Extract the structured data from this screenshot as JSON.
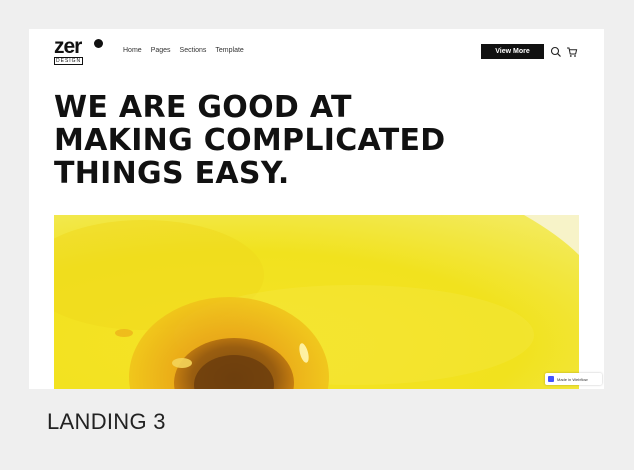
{
  "brand": {
    "wordmark": "zer",
    "sub": "DESIGN"
  },
  "nav": {
    "links": [
      "Home",
      "Pages",
      "Sections",
      "Template"
    ]
  },
  "actions": {
    "cta_label": "View More",
    "search_icon": "search-icon",
    "cart_icon": "cart-icon"
  },
  "hero": {
    "lines": [
      "WE ARE GOOD AT",
      "MAKING COMPLICATED",
      "THINGS EASY."
    ],
    "image_subject": "egg-yolk"
  },
  "badge": {
    "label": "Made in Webflow"
  },
  "caption": "LANDING 3",
  "colors": {
    "background": "#efefef",
    "card": "#ffffff",
    "text": "#111111",
    "accent_yellow": "#f0e21a",
    "yolk": "#e8a316"
  }
}
